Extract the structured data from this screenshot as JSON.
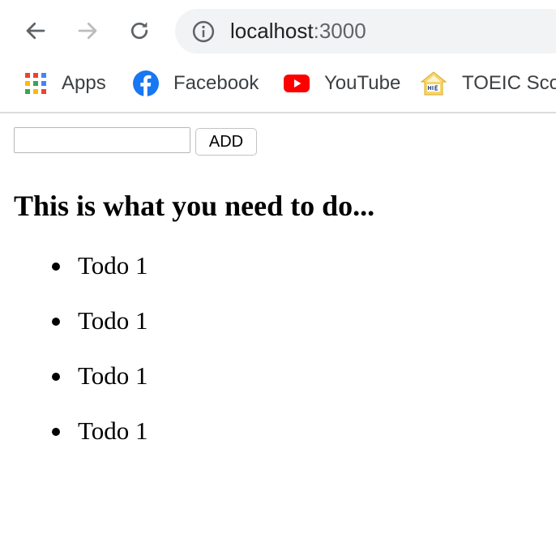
{
  "browser": {
    "url_host": "localhost",
    "url_port": ":3000",
    "icons": {
      "back": "arrow-left-icon",
      "forward": "arrow-right-icon",
      "reload": "reload-icon",
      "site_info": "info-circle-icon"
    }
  },
  "bookmarks": [
    {
      "label": "Apps",
      "icon": "apps-grid-icon"
    },
    {
      "label": "Facebook",
      "icon": "facebook-icon",
      "color": "#1877f2"
    },
    {
      "label": "YouTube",
      "icon": "youtube-icon",
      "color": "#ff0000"
    },
    {
      "label": "TOEIC Scor",
      "icon": "toeic-icon"
    }
  ],
  "page": {
    "add_label": "ADD",
    "input_value": "",
    "heading": "This is what you need to do...",
    "todos": [
      "Todo 1",
      "Todo 1",
      "Todo 1",
      "Todo 1"
    ]
  }
}
